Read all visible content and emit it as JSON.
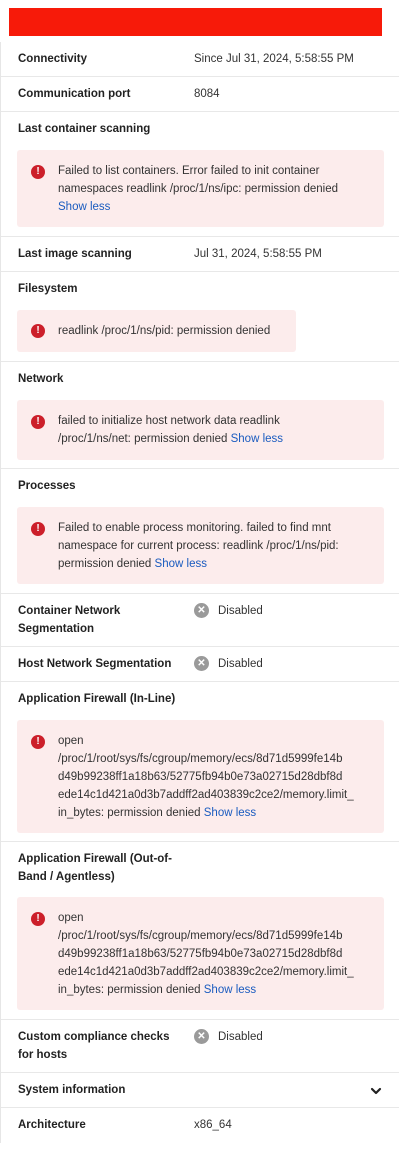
{
  "rows": {
    "connectivity": {
      "label": "Connectivity",
      "value": "Since Jul 31, 2024, 5:58:55 PM"
    },
    "communication_port": {
      "label": "Communication port",
      "value": "8084"
    },
    "last_container_scanning": {
      "label": "Last container scanning",
      "error_lines": [
        "Failed to list containers. Error failed to init container",
        "namespaces readlink /proc/1/ns/ipc: permission denied"
      ],
      "link": "Show less"
    },
    "last_image_scanning": {
      "label": "Last image scanning",
      "value": "Jul 31, 2024, 5:58:55 PM"
    },
    "filesystem": {
      "label": "Filesystem",
      "error_lines": [
        "readlink /proc/1/ns/pid: permission denied"
      ]
    },
    "network": {
      "label": "Network",
      "error_lines": [
        "failed to initialize host network data readlink",
        "/proc/1/ns/net: permission denied"
      ],
      "link": "Show less"
    },
    "processes": {
      "label": "Processes",
      "error_lines": [
        "Failed to enable process monitoring. failed to find mnt",
        "namespace for current process: readlink /proc/1/ns/pid:",
        "permission denied"
      ],
      "link": "Show less"
    },
    "container_network_segmentation": {
      "label_lines": [
        "Container Network",
        "Segmentation"
      ],
      "status": "Disabled"
    },
    "host_network_segmentation": {
      "label": "Host Network Segmentation",
      "status": "Disabled"
    },
    "app_firewall_inline": {
      "label": "Application Firewall (In-Line)",
      "error_lines": [
        "open",
        "/proc/1/root/sys/fs/cgroup/memory/ecs/8d71d5999fe14b",
        "d49b99238ff1a18b63/52775fb94b0e73a02715d28dbf8d",
        "ede14c1d421a0d3b7addff2ad403839c2ce2/memory.limit_",
        "in_bytes: permission denied"
      ],
      "link": "Show less"
    },
    "app_firewall_oob": {
      "label_lines": [
        "Application Firewall (Out-of-",
        "Band / Agentless)"
      ],
      "error_lines": [
        "open",
        "/proc/1/root/sys/fs/cgroup/memory/ecs/8d71d5999fe14b",
        "d49b99238ff1a18b63/52775fb94b0e73a02715d28dbf8d",
        "ede14c1d421a0d3b7addff2ad403839c2ce2/memory.limit_",
        "in_bytes: permission denied"
      ],
      "link": "Show less"
    },
    "custom_compliance": {
      "label_lines": [
        "Custom compliance checks",
        "for hosts"
      ],
      "status": "Disabled"
    },
    "system_information": {
      "label": "System information"
    },
    "architecture": {
      "label": "Architecture",
      "value": "x86_64"
    }
  },
  "icons": {
    "error": "exclamation-circle-icon",
    "disabled": "x-circle-icon",
    "chevron": "chevron-down-icon"
  },
  "colors": {
    "error_bg": "#fcecec",
    "error_icon": "#cc1f2a",
    "link": "#1a5bbf",
    "header_red": "#f71a09"
  }
}
